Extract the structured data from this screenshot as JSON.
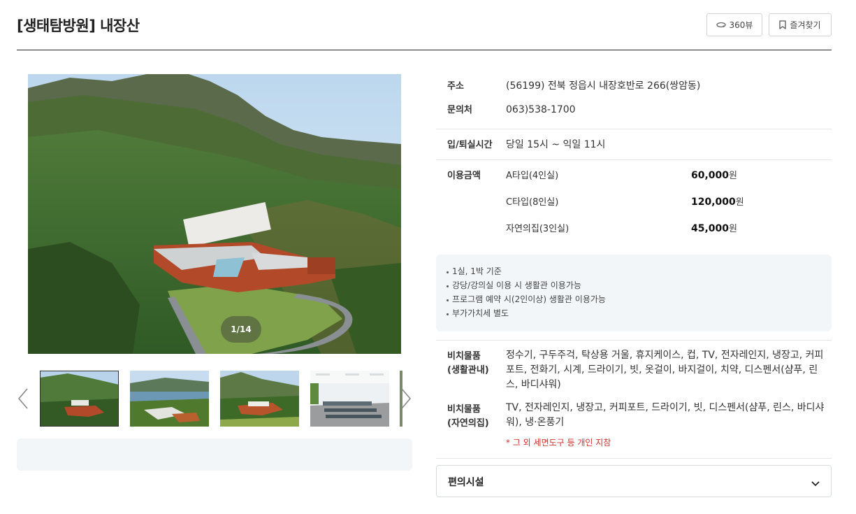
{
  "header": {
    "title": "[생태탐방원] 내장산",
    "view360_label": "360뷰",
    "favorite_label": "즐겨찾기"
  },
  "gallery": {
    "counter": "1/14",
    "current_index": 1,
    "total": 14
  },
  "info": {
    "address": {
      "label": "주소",
      "value": "(56199) 전북 정읍시 내장호반로 266(쌍암동)"
    },
    "contact": {
      "label": "문의처",
      "value": "063)538-1700"
    },
    "checkin": {
      "label": "입/퇴실시간",
      "value": "당일 15시 ~ 익일 11시"
    },
    "price": {
      "label": "이용금액",
      "rows": [
        {
          "name": "A타입(4인실)",
          "amount": "60,000",
          "unit": "원"
        },
        {
          "name": "C타입(8인실)",
          "amount": "120,000",
          "unit": "원"
        },
        {
          "name": "자연의집(3인실)",
          "amount": "45,000",
          "unit": "원"
        }
      ]
    },
    "notices": [
      "1실, 1박 기준",
      "강당/강의실 이용 시 생활관 이용가능",
      "프로그램 예약 시(2인이상) 생활관 이용가능",
      "부가가치세 별도"
    ],
    "amenities": [
      {
        "label": "비치물품\n(생활관내)",
        "value": "정수기, 구두주걱, 탁상용 거울, 휴지케이스, 컵, TV, 전자레인지, 냉장고, 커피포트, 전화기, 시계, 드라이기, 빗, 옷걸이, 바지걸이, 치약, 디스펜서(샴푸, 린스, 바디샤워)"
      },
      {
        "label": "비치물품\n(자연의집)",
        "value": "TV, 전자레인지, 냉장고, 커피포트, 드라이기, 빗, 디스펜서(샴푸, 린스, 바디샤워), 냉·온풍기"
      }
    ],
    "warning": "* 그 외 세면도구 등 개인 지참",
    "accordion_title": "편의시설"
  },
  "colors": {
    "accent_warning": "#d0312d",
    "notice_bg": "#f3f6f9",
    "border": "#d7dbe0"
  },
  "icons": [
    "360-view-icon",
    "bookmark-icon",
    "chevron-left-icon",
    "chevron-right-icon",
    "chevron-down-icon"
  ]
}
